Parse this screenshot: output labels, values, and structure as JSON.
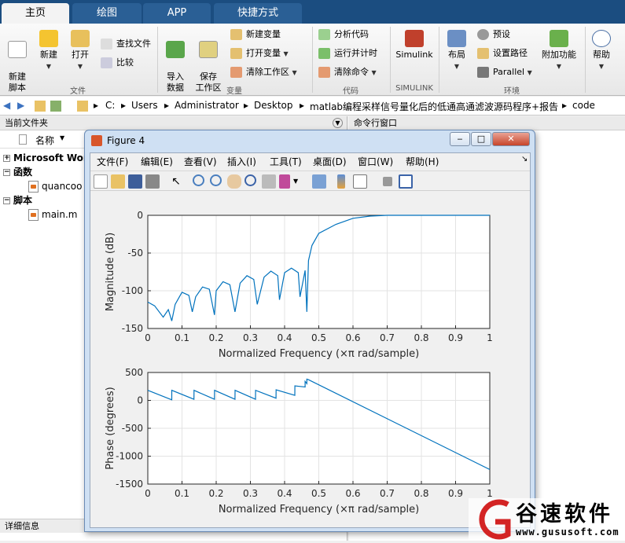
{
  "tabs": [
    {
      "label": "主页",
      "active": true
    },
    {
      "label": "绘图",
      "active": false
    },
    {
      "label": "APP",
      "active": false
    },
    {
      "label": "快捷方式",
      "active": false
    }
  ],
  "ribbon": {
    "new_script": "新建\n脚本",
    "new": "新建",
    "open": "打开",
    "find_files": "查找文件",
    "compare": "比较",
    "import": "导入\n数据",
    "save_ws": "保存\n工作区",
    "new_var": "新建变量",
    "open_var": "打开变量",
    "clear_ws": "清除工作区",
    "analyze": "分析代码",
    "run_time": "运行并计时",
    "clear_cmd": "清除命令",
    "simulink": "Simulink",
    "layout": "布局",
    "prefs": "预设",
    "set_path": "设置路径",
    "parallel": "Parallel",
    "addons": "附加功能",
    "help": "帮助",
    "groups": {
      "file": "文件",
      "var": "变量",
      "code": "代码",
      "simulink": "SIMULINK",
      "env": "环境"
    }
  },
  "address": {
    "crumbs": [
      "C:",
      "Users",
      "Administrator",
      "Desktop",
      "matlab编程采样信号量化后的低通高通滤波源码程序+报告",
      "code"
    ]
  },
  "filepane": {
    "title": "当前文件夹",
    "col_name": "名称",
    "groups": [
      {
        "label": "Microsoft Wor",
        "items": []
      },
      {
        "label": "函数",
        "items": [
          "quancoo"
        ]
      },
      {
        "label": "脚本",
        "items": [
          "main.m"
        ]
      }
    ],
    "details": "详细信息"
  },
  "cmdpane": {
    "title": "命令行窗口"
  },
  "figure": {
    "title": "Figure 4",
    "menu": [
      "文件(F)",
      "编辑(E)",
      "查看(V)",
      "插入(I)",
      "工具(T)",
      "桌面(D)",
      "窗口(W)",
      "帮助(H)"
    ]
  },
  "chart_data": [
    {
      "type": "line",
      "ylabel": "Magnitude (dB)",
      "xlabel": "Normalized Frequency  (×π rad/sample)",
      "xlim": [
        0,
        1
      ],
      "ylim": [
        -150,
        0
      ],
      "xticks": [
        "0",
        "0.1",
        "0.2",
        "0.3",
        "0.4",
        "0.5",
        "0.6",
        "0.7",
        "0.8",
        "0.9",
        "1"
      ],
      "yticks": [
        "0",
        "-50",
        "-100",
        "-150"
      ],
      "grid": true,
      "x": [
        0,
        0.02,
        0.045,
        0.06,
        0.07,
        0.08,
        0.1,
        0.12,
        0.13,
        0.14,
        0.16,
        0.18,
        0.195,
        0.2,
        0.22,
        0.24,
        0.255,
        0.27,
        0.29,
        0.31,
        0.32,
        0.34,
        0.36,
        0.38,
        0.385,
        0.4,
        0.42,
        0.44,
        0.445,
        0.46,
        0.465,
        0.47,
        0.48,
        0.5,
        0.55,
        0.6,
        0.65,
        0.7,
        0.8,
        0.9,
        1.0
      ],
      "y": [
        -115,
        -120,
        -135,
        -125,
        -140,
        -118,
        -102,
        -106,
        -128,
        -108,
        -95,
        -98,
        -132,
        -100,
        -88,
        -92,
        -128,
        -90,
        -80,
        -85,
        -118,
        -82,
        -74,
        -80,
        -112,
        -76,
        -70,
        -76,
        -108,
        -73,
        -128,
        -60,
        -40,
        -24,
        -12,
        -4,
        -1,
        0,
        0,
        0,
        0
      ]
    },
    {
      "type": "line",
      "ylabel": "Phase (degrees)",
      "xlabel": "Normalized Frequency  (×π rad/sample)",
      "xlim": [
        0,
        1
      ],
      "ylim": [
        -1500,
        500
      ],
      "xticks": [
        "0",
        "0.1",
        "0.2",
        "0.3",
        "0.4",
        "0.5",
        "0.6",
        "0.7",
        "0.8",
        "0.9",
        "1"
      ],
      "yticks": [
        "500",
        "0",
        "-500",
        "-1000",
        "-1500"
      ],
      "grid": true,
      "x": [
        0,
        0.07,
        0.0701,
        0.135,
        0.1351,
        0.195,
        0.1951,
        0.255,
        0.2551,
        0.315,
        0.3151,
        0.375,
        0.3751,
        0.43,
        0.4301,
        0.46,
        0.4601,
        0.465,
        0.4651,
        0.47,
        1.0
      ],
      "y": [
        180,
        10,
        180,
        20,
        180,
        20,
        180,
        20,
        180,
        20,
        180,
        40,
        190,
        90,
        260,
        240,
        340,
        300,
        380,
        370,
        -1240
      ]
    }
  ],
  "watermark": {
    "brand": "谷速软件",
    "url": "www.gususoft.com"
  }
}
